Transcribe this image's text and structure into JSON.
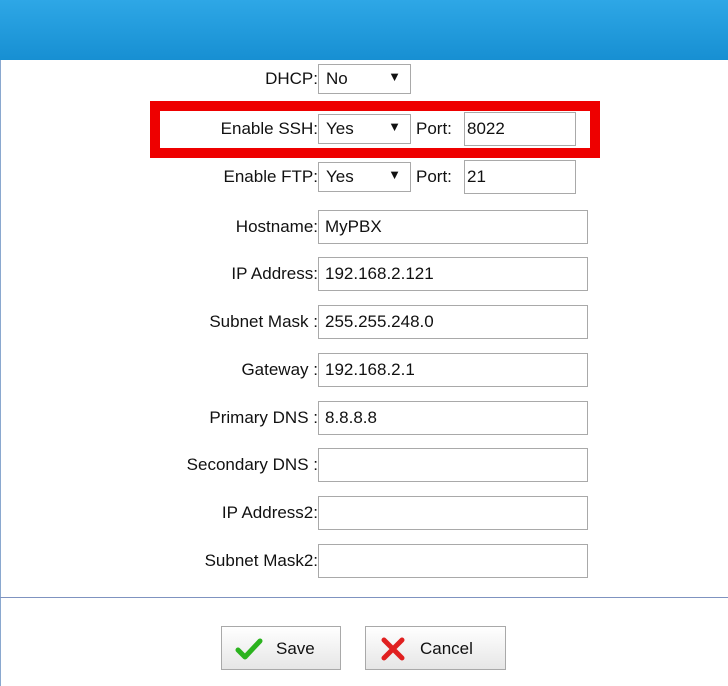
{
  "form": {
    "dhcp": {
      "label": "DHCP:",
      "value": "No"
    },
    "ssh": {
      "label": "Enable SSH:",
      "value": "Yes",
      "port_label": "Port:",
      "port_value": "8022"
    },
    "ftp": {
      "label": "Enable FTP:",
      "value": "Yes",
      "port_label": "Port:",
      "port_value": "21"
    },
    "hostname": {
      "label": "Hostname:",
      "value": "MyPBX"
    },
    "ip_address": {
      "label": "IP Address:",
      "value": "192.168.2.121"
    },
    "subnet_mask": {
      "label": "Subnet Mask :",
      "value": "255.255.248.0"
    },
    "gateway": {
      "label": "Gateway :",
      "value": "192.168.2.1"
    },
    "primary_dns": {
      "label": "Primary DNS :",
      "value": "8.8.8.8"
    },
    "secondary_dns": {
      "label": "Secondary DNS :",
      "value": ""
    },
    "ip_address2": {
      "label": "IP Address2:",
      "value": ""
    },
    "subnet_mask2": {
      "label": "Subnet Mask2:",
      "value": ""
    }
  },
  "actions": {
    "save_label": "Save",
    "cancel_label": "Cancel"
  },
  "icons": {
    "select_arrow": "triangle-down",
    "save": "checkmark-icon",
    "cancel": "x-icon"
  },
  "colors": {
    "header": "#1e9ad9",
    "highlight": "#ee0000",
    "save_check": "#2bb31e",
    "cancel_x": "#e02020"
  }
}
